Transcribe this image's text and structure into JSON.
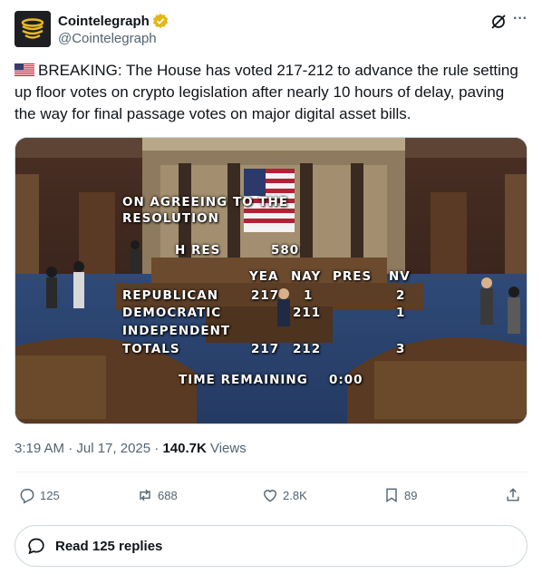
{
  "author": {
    "name": "Cointelegraph",
    "handle": "@Cointelegraph"
  },
  "tweet": {
    "text": "BREAKING: The House has voted 217-212 to advance the rule setting up floor votes on crypto legislation after nearly 10 hours of delay, paving the way for final passage votes on major digital asset bills."
  },
  "media": {
    "vote_board": {
      "heading_line1": "ON AGREEING TO THE",
      "heading_line2": "RESOLUTION",
      "measure_label": "H RES",
      "measure_number": "580",
      "col_yea": "YEA",
      "col_nay": "NAY",
      "col_pres": "PRES",
      "col_nv": "NV",
      "rows": [
        {
          "party": "REPUBLICAN",
          "yea": "217",
          "nay": "1",
          "pres": "",
          "nv": "2"
        },
        {
          "party": "DEMOCRATIC",
          "yea": "",
          "nay": "211",
          "pres": "",
          "nv": "1"
        },
        {
          "party": "INDEPENDENT",
          "yea": "",
          "nay": "",
          "pres": "",
          "nv": ""
        },
        {
          "party": "TOTALS",
          "yea": "217",
          "nay": "212",
          "pres": "",
          "nv": "3"
        }
      ],
      "time_label": "TIME REMAINING",
      "time_value": "0:00"
    }
  },
  "meta": {
    "timestamp": "3:19 AM · Jul 17, 2025 · ",
    "views_count": "140.7K",
    "views_label": " Views"
  },
  "actions": {
    "replies": "125",
    "reposts": "688",
    "likes": "2.8K",
    "bookmarks": "89"
  },
  "read_replies_label": "Read 125 replies",
  "colors": {
    "text_primary": "#0f1419",
    "text_secondary": "#536471",
    "verified_gold": "#e2b719",
    "border": "#cfd9de"
  },
  "icons": [
    "verified-badge-icon",
    "grok-icon",
    "more-icon",
    "us-flag-icon",
    "reply-icon",
    "repost-icon",
    "like-icon",
    "bookmark-icon",
    "share-icon",
    "speech-bubble-icon"
  ]
}
